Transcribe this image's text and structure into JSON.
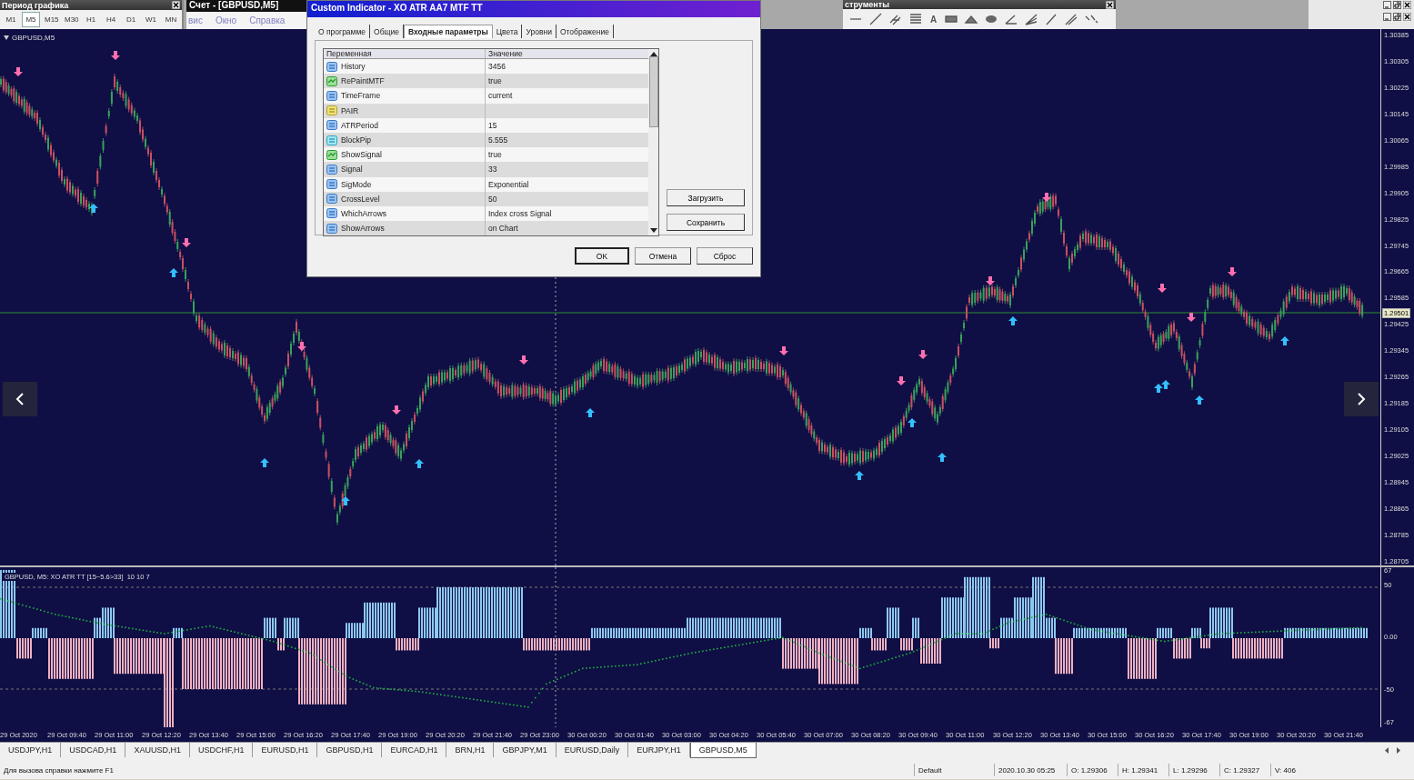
{
  "period_toolbar": {
    "title": "Период графика",
    "timeframes": [
      {
        "label": "M1",
        "selected": false
      },
      {
        "label": "M5",
        "selected": true
      },
      {
        "label": "M15",
        "selected": false
      },
      {
        "label": "M30",
        "selected": false
      },
      {
        "label": "H1",
        "selected": false
      },
      {
        "label": "H4",
        "selected": false
      },
      {
        "label": "D1",
        "selected": false
      },
      {
        "label": "W1",
        "selected": false
      },
      {
        "label": "MN",
        "selected": false
      }
    ]
  },
  "account_window": {
    "title": "Счет - [GBPUSD,M5]",
    "menu": [
      "вис",
      "Окно",
      "Справка"
    ]
  },
  "drawing_toolbar": {
    "title": "струменты",
    "text_tool": "A"
  },
  "chart": {
    "symbol_label": "GBPUSD,M5",
    "price_labels": [
      "1.30385",
      "1.30305",
      "1.30225",
      "1.30145",
      "1.30065",
      "1.29985",
      "1.29905",
      "1.29825",
      "1.29745",
      "1.29665",
      "1.29585",
      "1.29425",
      "1.29345",
      "1.29265",
      "1.29185",
      "1.29105",
      "1.29025",
      "1.28945",
      "1.28865",
      "1.28785",
      "1.28705"
    ],
    "current_price": "1.29501"
  },
  "indicator": {
    "label": "GBPUSD, M5: XO ATR TT [15~5.6>33]  10 10 7",
    "scale_labels": [
      "67",
      "50",
      "0.00",
      "-50",
      "-67"
    ]
  },
  "time_labels": [
    "29 Oct 2020",
    "29 Oct 09:40",
    "29 Oct 11:00",
    "29 Oct 12:20",
    "29 Oct 13:40",
    "29 Oct 15:00",
    "29 Oct 16:20",
    "29 Oct 17:40",
    "29 Oct 19:00",
    "29 Oct 20:20",
    "29 Oct 21:40",
    "29 Oct 23:00",
    "30 Oct 00:20",
    "30 Oct 01:40",
    "30 Oct 03:00",
    "30 Oct 04:20",
    "30 Oct 05:40",
    "30 Oct 07:00",
    "30 Oct 08:20",
    "30 Oct 09:40",
    "30 Oct 11:00",
    "30 Oct 12:20",
    "30 Oct 13:40",
    "30 Oct 15:00",
    "30 Oct 16:20",
    "30 Oct 17:40",
    "30 Oct 19:00",
    "30 Oct 20:20",
    "30 Oct 21:40"
  ],
  "chart_tabs": [
    {
      "label": "USDJPY,H1",
      "selected": false
    },
    {
      "label": "USDCAD,H1",
      "selected": false
    },
    {
      "label": "XAUUSD,H1",
      "selected": false
    },
    {
      "label": "USDCHF,H1",
      "selected": false
    },
    {
      "label": "EURUSD,H1",
      "selected": false
    },
    {
      "label": "GBPUSD,H1",
      "selected": false
    },
    {
      "label": "EURCAD,H1",
      "selected": false
    },
    {
      "label": "BRN,H1",
      "selected": false
    },
    {
      "label": "GBPJPY,M1",
      "selected": false
    },
    {
      "label": "EURUSD,Daily",
      "selected": false
    },
    {
      "label": "EURJPY,H1",
      "selected": false
    },
    {
      "label": "GBPUSD,M5",
      "selected": true
    }
  ],
  "status_bar": {
    "help": "Для вызова справки нажмите F1",
    "profile": "Default",
    "time": "2020.10.30 05:25",
    "open": "O: 1.29306",
    "high": "H: 1.29341",
    "low": "L: 1.29296",
    "close": "C: 1.29327",
    "volume": "V: 406"
  },
  "dialog": {
    "title": "Custom Indicator - XO ATR AA7 MTF TT",
    "tabs": [
      {
        "label": "О программе",
        "selected": false
      },
      {
        "label": "Общие",
        "selected": false
      },
      {
        "label": "Входные параметры",
        "selected": true
      },
      {
        "label": "Цвета",
        "selected": false
      },
      {
        "label": "Уровни",
        "selected": false
      },
      {
        "label": "Отображение",
        "selected": false
      }
    ],
    "columns": [
      "Переменная",
      "Значение"
    ],
    "params": [
      {
        "kind": "int",
        "name": "History",
        "value": "3456"
      },
      {
        "kind": "bool",
        "name": "RePaintMTF",
        "value": "true"
      },
      {
        "kind": "int",
        "name": "TimeFrame",
        "value": "current"
      },
      {
        "kind": "string",
        "name": "PAIR"
      },
      {
        "kind": "int",
        "name": "ATRPeriod",
        "value": "15"
      },
      {
        "kind": "double",
        "name": "BlockPip",
        "value": "5.555"
      },
      {
        "kind": "bool",
        "name": "ShowSignal",
        "value": "true"
      },
      {
        "kind": "int",
        "name": "Signal",
        "value": "33"
      },
      {
        "kind": "int",
        "name": "SigMode",
        "value": "Exponential"
      },
      {
        "kind": "int",
        "name": "CrossLevel",
        "value": "50"
      },
      {
        "kind": "int",
        "name": "WhichArrows",
        "value": "Index cross Signal"
      },
      {
        "kind": "int",
        "name": "ShowArrows",
        "value": "on Chart"
      }
    ],
    "side_buttons": [
      "Загрузить",
      "Сохранить"
    ],
    "buttons": [
      "OK",
      "Отмена",
      "Сброс"
    ]
  }
}
